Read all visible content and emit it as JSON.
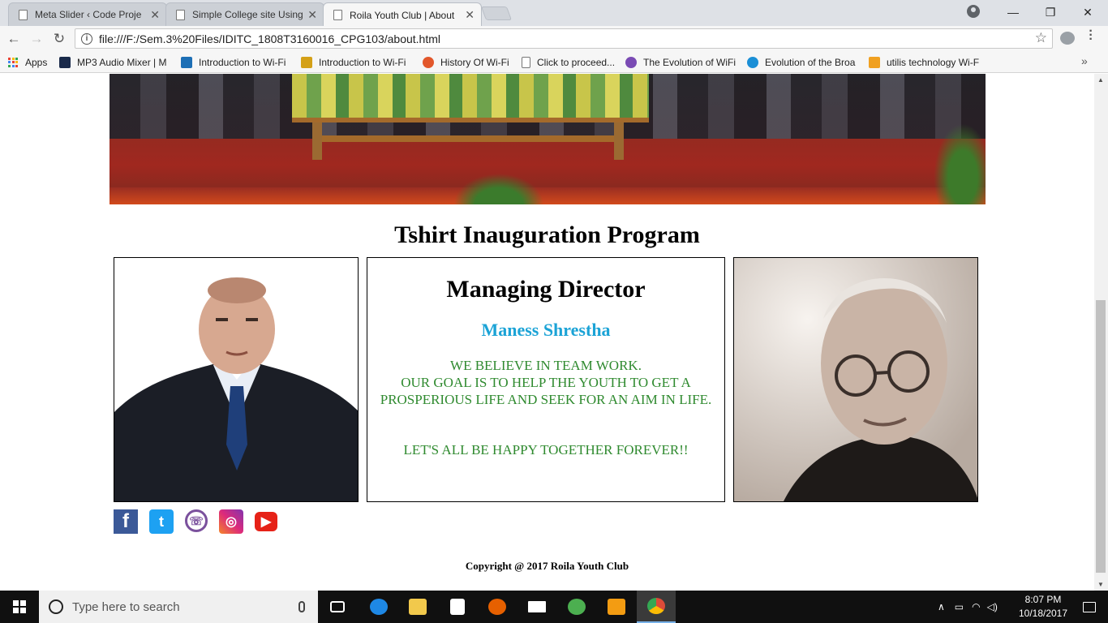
{
  "browser": {
    "tabs": [
      {
        "title": "Meta Slider ‹ Code Proje",
        "active": false
      },
      {
        "title": "Simple College site Using",
        "active": false
      },
      {
        "title": "Roila Youth Club | About",
        "active": true
      }
    ],
    "close_glyph": "✕",
    "url": "file:///F:/Sem.3%20Files/IDITC_1808T3160016_CPG103/about.html",
    "window_controls": {
      "minimize": "—",
      "maximize": "❐",
      "close": "✕"
    },
    "bookmarks": [
      {
        "label": "Apps",
        "icon": "apps-grid-icon"
      },
      {
        "label": "MP3 Audio Mixer | M",
        "icon": "audio-mixer-icon",
        "color": "#1a2a4a"
      },
      {
        "label": "Introduction to Wi-Fi",
        "icon": "wifi-site-icon",
        "color": "#1d6fb5"
      },
      {
        "label": "Introduction to Wi-Fi",
        "icon": "wifi-site-icon-2",
        "color": "#d4a017"
      },
      {
        "label": "History Of Wi-Fi",
        "icon": "history-icon",
        "color": "#e2572b"
      },
      {
        "label": "Click to proceed...",
        "icon": "page-icon",
        "color": "#ffffff"
      },
      {
        "label": "The Evolution of WiFi",
        "icon": "wifi-evolution-icon",
        "color": "#7a4bb4"
      },
      {
        "label": "Evolution of the Broa",
        "icon": "broadband-icon",
        "color": "#1b8fd6"
      },
      {
        "label": "utilis technology Wi-F",
        "icon": "utilis-icon",
        "color": "#f0a020"
      }
    ],
    "bookmarks_overflow": "»"
  },
  "page": {
    "program_title": "Tshirt Inauguration Program",
    "director": {
      "heading": "Managing Director",
      "name": "Maness Shrestha",
      "message_line1": "WE BELIEVE IN TEAM WORK.",
      "message_line2": "OUR GOAL IS TO HELP THE YOUTH TO GET A PROSPERIOUS LIFE AND SEEK FOR AN AIM IN LIFE.",
      "message_line3": "LET'S ALL BE HAPPY TOGETHER FOREVER!!"
    },
    "social": [
      {
        "name": "facebook-icon",
        "glyph": "f"
      },
      {
        "name": "twitter-icon",
        "glyph": "t"
      },
      {
        "name": "viber-icon",
        "glyph": "☏"
      },
      {
        "name": "instagram-icon",
        "glyph": "◎"
      },
      {
        "name": "youtube-icon",
        "glyph": "▶"
      }
    ],
    "copyright": "Copyright @ 2017 Roila Youth Club"
  },
  "taskbar": {
    "search_placeholder": "Type here to search",
    "time": "8:07 PM",
    "date": "10/18/2017",
    "apps": [
      {
        "name": "task-view-icon",
        "color": "#ffffff"
      },
      {
        "name": "edge-icon",
        "color": "#1e88e5"
      },
      {
        "name": "file-explorer-icon",
        "color": "#f2c94c"
      },
      {
        "name": "store-icon",
        "color": "#ffffff"
      },
      {
        "name": "firefox-icon",
        "color": "#e66000"
      },
      {
        "name": "mail-icon",
        "color": "#ffffff"
      },
      {
        "name": "utorrent-icon",
        "color": "#4caf50"
      },
      {
        "name": "media-player-icon",
        "color": "#f39c12"
      },
      {
        "name": "chrome-icon",
        "color": "#dd4b39"
      }
    ]
  }
}
